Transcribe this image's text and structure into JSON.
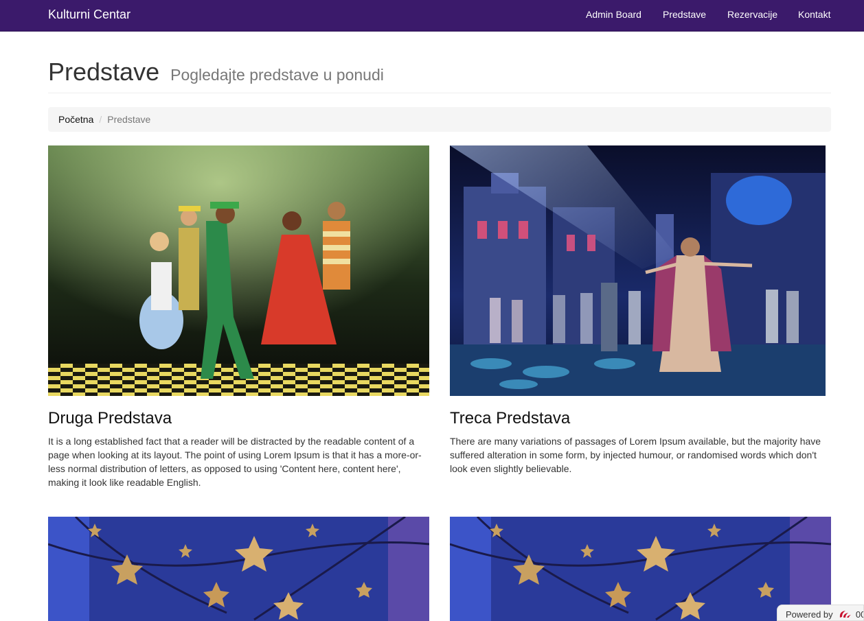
{
  "navbar": {
    "brand": "Kulturni Centar",
    "items": [
      "Admin Board",
      "Predstave",
      "Rezervacije",
      "Kontakt"
    ],
    "background_color": "#3b1a6b"
  },
  "header": {
    "title": "Predstave",
    "subtitle": "Pogledajte predstave u ponudi"
  },
  "breadcrumb": {
    "home": "Početna",
    "current": "Predstave"
  },
  "shows": [
    {
      "title": "Druga Predstava",
      "description": "It is a long established fact that a reader will be distracted by the readable content of a page when looking at its layout. The point of using Lorem Ipsum is that it has a more-or-less normal distribution of letters, as opposed to using 'Content here, content here', making it look like readable English."
    },
    {
      "title": "Treca Predstava",
      "description": "There are many variations of passages of Lorem Ipsum available, but the majority have suffered alteration in some form, by injected humour, or randomised words which don't look even slightly believable."
    },
    {
      "title": "",
      "description": ""
    },
    {
      "title": "",
      "description": ""
    }
  ],
  "footer_badge": {
    "text": "Powered by",
    "trail": "00"
  }
}
